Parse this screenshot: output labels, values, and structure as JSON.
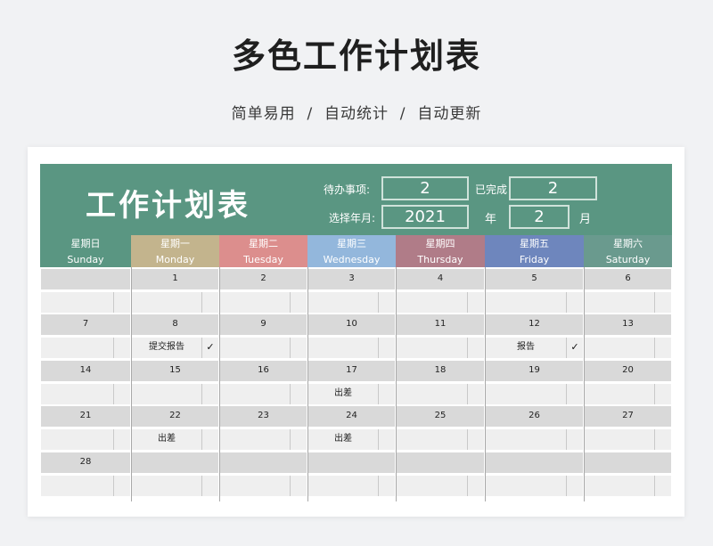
{
  "page": {
    "title": "多色工作计划表",
    "subtitle": "简单易用  /  自动统计  /  自动更新"
  },
  "header": {
    "title": "工作计划表",
    "pending_label": "待办事项:",
    "pending_value": "2",
    "done_label": "已完成",
    "done_value": "2",
    "select_label": "选择年月:",
    "year_value": "2021",
    "year_unit": "年",
    "month_value": "2",
    "month_unit": "月"
  },
  "colors": {
    "header": "#5a9682",
    "sunday": "#5a9682",
    "monday": "#c3b48d",
    "tuesday": "#dc8e8d",
    "wednesday": "#93b7dc",
    "thursday": "#b07c88",
    "friday": "#6e86bd",
    "saturday": "#6a9a8e"
  },
  "days": [
    {
      "zh": "星期日",
      "en": "Sunday"
    },
    {
      "zh": "星期一",
      "en": "Monday"
    },
    {
      "zh": "星期二",
      "en": "Tuesday"
    },
    {
      "zh": "星期三",
      "en": "Wednesday"
    },
    {
      "zh": "星期四",
      "en": "Thursday"
    },
    {
      "zh": "星期五",
      "en": "Friday"
    },
    {
      "zh": "星期六",
      "en": "Saturday"
    }
  ],
  "weeks": [
    [
      {
        "date": "",
        "task": "",
        "check": ""
      },
      {
        "date": "1",
        "task": "",
        "check": ""
      },
      {
        "date": "2",
        "task": "",
        "check": ""
      },
      {
        "date": "3",
        "task": "",
        "check": ""
      },
      {
        "date": "4",
        "task": "",
        "check": ""
      },
      {
        "date": "5",
        "task": "",
        "check": ""
      },
      {
        "date": "6",
        "task": "",
        "check": ""
      }
    ],
    [
      {
        "date": "7",
        "task": "",
        "check": ""
      },
      {
        "date": "8",
        "task": "提交报告",
        "check": "✓"
      },
      {
        "date": "9",
        "task": "",
        "check": ""
      },
      {
        "date": "10",
        "task": "",
        "check": ""
      },
      {
        "date": "11",
        "task": "",
        "check": ""
      },
      {
        "date": "12",
        "task": "报告",
        "check": "✓"
      },
      {
        "date": "13",
        "task": "",
        "check": ""
      }
    ],
    [
      {
        "date": "14",
        "task": "",
        "check": ""
      },
      {
        "date": "15",
        "task": "",
        "check": ""
      },
      {
        "date": "16",
        "task": "",
        "check": ""
      },
      {
        "date": "17",
        "task": "出差",
        "check": ""
      },
      {
        "date": "18",
        "task": "",
        "check": ""
      },
      {
        "date": "19",
        "task": "",
        "check": ""
      },
      {
        "date": "20",
        "task": "",
        "check": ""
      }
    ],
    [
      {
        "date": "21",
        "task": "",
        "check": ""
      },
      {
        "date": "22",
        "task": "出差",
        "check": ""
      },
      {
        "date": "23",
        "task": "",
        "check": ""
      },
      {
        "date": "24",
        "task": "出差",
        "check": ""
      },
      {
        "date": "25",
        "task": "",
        "check": ""
      },
      {
        "date": "26",
        "task": "",
        "check": ""
      },
      {
        "date": "27",
        "task": "",
        "check": ""
      }
    ],
    [
      {
        "date": "28",
        "task": "",
        "check": ""
      },
      {
        "date": "",
        "task": "",
        "check": ""
      },
      {
        "date": "",
        "task": "",
        "check": ""
      },
      {
        "date": "",
        "task": "",
        "check": ""
      },
      {
        "date": "",
        "task": "",
        "check": ""
      },
      {
        "date": "",
        "task": "",
        "check": ""
      },
      {
        "date": "",
        "task": "",
        "check": ""
      }
    ]
  ]
}
